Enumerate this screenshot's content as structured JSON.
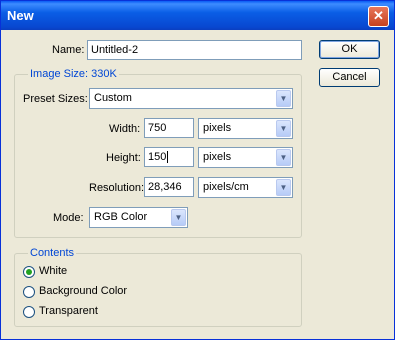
{
  "window": {
    "title": "New"
  },
  "name": {
    "label": "Name:",
    "value": "Untitled-2"
  },
  "buttons": {
    "ok": "OK",
    "cancel": "Cancel"
  },
  "image_size": {
    "title": "Image Size: 330K",
    "preset": {
      "label": "Preset Sizes:",
      "value": "Custom"
    },
    "width": {
      "label": "Width:",
      "value": "750",
      "unit": "pixels"
    },
    "height": {
      "label": "Height:",
      "value": "150",
      "unit": "pixels"
    },
    "resolution": {
      "label": "Resolution:",
      "value": "28,346",
      "unit": "pixels/cm"
    },
    "mode": {
      "label": "Mode:",
      "value": "RGB Color"
    }
  },
  "contents": {
    "title": "Contents",
    "options": [
      "White",
      "Background Color",
      "Transparent"
    ],
    "selected": "White"
  }
}
